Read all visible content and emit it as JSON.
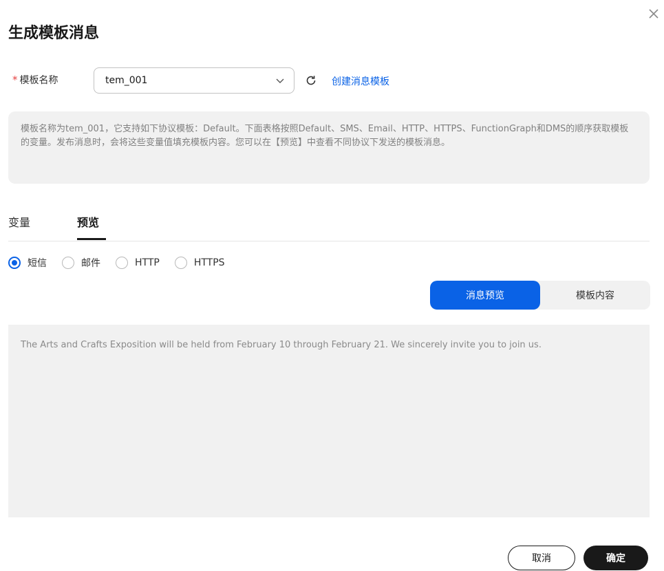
{
  "dialog": {
    "title": "生成模板消息",
    "close_icon": "close-icon"
  },
  "template_name": {
    "required_mark": "*",
    "label": "模板名称",
    "value": "tem_001",
    "dropdown_icon": "chevron-down-icon",
    "refresh_icon": "refresh-icon",
    "create_link": "创建消息模板"
  },
  "info_text": "模板名称为tem_001，它支持如下协议模板：Default。下面表格按照Default、SMS、Email、HTTP、HTTPS、FunctionGraph和DMS的顺序获取模板的变量。发布消息时，会将这些变量值填充模板内容。您可以在【预览】中查看不同协议下发送的模板消息。",
  "tabs": [
    {
      "label": "变量",
      "active": false
    },
    {
      "label": "预览",
      "active": true
    }
  ],
  "protocols": [
    {
      "label": "短信",
      "checked": true
    },
    {
      "label": "邮件",
      "checked": false
    },
    {
      "label": "HTTP",
      "checked": false
    },
    {
      "label": "HTTPS",
      "checked": false
    }
  ],
  "segment": {
    "preview_label": "消息预览",
    "content_label": "模板内容",
    "active": "preview"
  },
  "preview_text": "The Arts and Crafts Exposition will be held from February 10 through February 21. We sincerely invite you to join us.",
  "footer": {
    "cancel_label": "取消",
    "ok_label": "确定"
  },
  "colors": {
    "accent": "#0a62e6",
    "required": "#e54545",
    "primary_button": "#191919"
  }
}
